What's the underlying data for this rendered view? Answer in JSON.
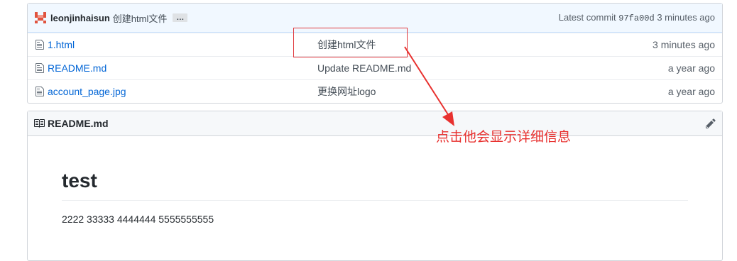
{
  "commit": {
    "author": "leonjinhaisun",
    "message": "创建html文件",
    "ellipsis": "…",
    "latest_label": "Latest commit",
    "sha": "97fa00d",
    "age": "3 minutes ago"
  },
  "files": [
    {
      "name": "1.html",
      "message": "创建html文件",
      "age": "3 minutes ago"
    },
    {
      "name": "README.md",
      "message": "Update README.md",
      "age": "a year ago"
    },
    {
      "name": "account_page.jpg",
      "message": "更换网址logo",
      "age": "a year ago"
    }
  ],
  "readme": {
    "filename": "README.md",
    "title": "test",
    "text": "2222 33333 4444444 5555555555"
  },
  "annotation": {
    "text": "点击他会显示详细信息",
    "color": "#e8312f"
  },
  "icons": {
    "file": "file-icon",
    "book": "book-icon",
    "edit": "pencil-icon",
    "avatar": "identicon-avatar"
  }
}
